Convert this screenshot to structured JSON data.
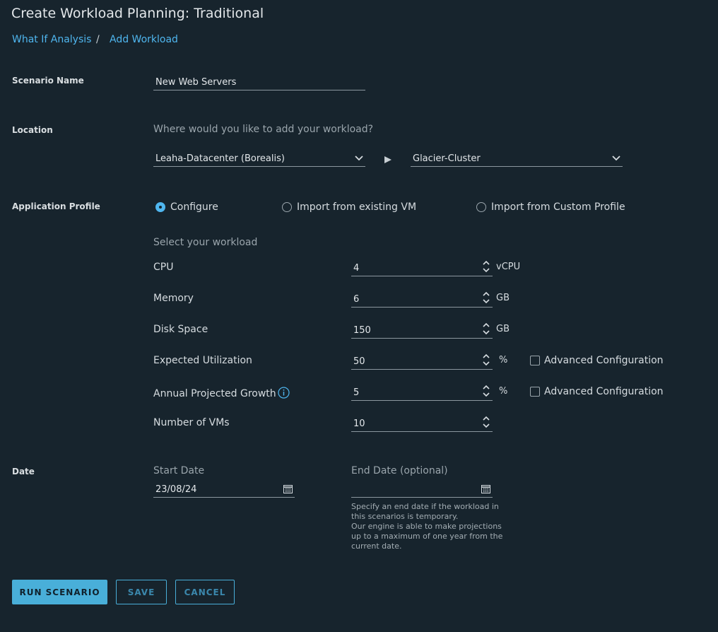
{
  "page": {
    "title": "Create Workload Planning: Traditional",
    "breadcrumb": [
      {
        "label": "What If Analysis"
      },
      {
        "label": "Add Workload"
      }
    ],
    "breadcrumb_separator": "/"
  },
  "scenario": {
    "label": "Scenario Name",
    "value": "New Web Servers"
  },
  "location": {
    "label": "Location",
    "hint": "Where would you like to add your workload?",
    "datacenter": "Leaha-Datacenter (Borealis)",
    "cluster": "Glacier-Cluster"
  },
  "app_profile": {
    "label": "Application Profile",
    "options": [
      {
        "label": "Configure",
        "selected": true
      },
      {
        "label": "Import from existing VM",
        "selected": false
      },
      {
        "label": "Import from Custom Profile",
        "selected": false
      }
    ],
    "workload_hint": "Select your workload",
    "rows": [
      {
        "label": "CPU",
        "value": "4",
        "unit": "vCPU"
      },
      {
        "label": "Memory",
        "value": "6",
        "unit": "GB"
      },
      {
        "label": "Disk Space",
        "value": "150",
        "unit": "GB"
      },
      {
        "label": "Expected Utilization",
        "value": "50",
        "unit": "%",
        "advanced": "Advanced Configuration"
      },
      {
        "label": "Annual Projected Growth",
        "value": "5",
        "unit": "%",
        "advanced": "Advanced Configuration"
      },
      {
        "label": "Number of VMs",
        "value": "10"
      }
    ]
  },
  "date": {
    "label": "Date",
    "start_label": "Start Date",
    "start_value": "23/08/24",
    "end_label": "End Date (optional)",
    "end_value": "",
    "end_hint_1": "Specify an end date if the workload in this scenarios is temporary.",
    "end_hint_2": "Our engine is able to make projections up to a maximum of one year from the current date."
  },
  "buttons": {
    "run": "RUN SCENARIO",
    "save": "SAVE",
    "cancel": "CANCEL"
  },
  "colors": {
    "background": "#17242d",
    "accent": "#49afd9",
    "link": "#4fb6ef"
  }
}
